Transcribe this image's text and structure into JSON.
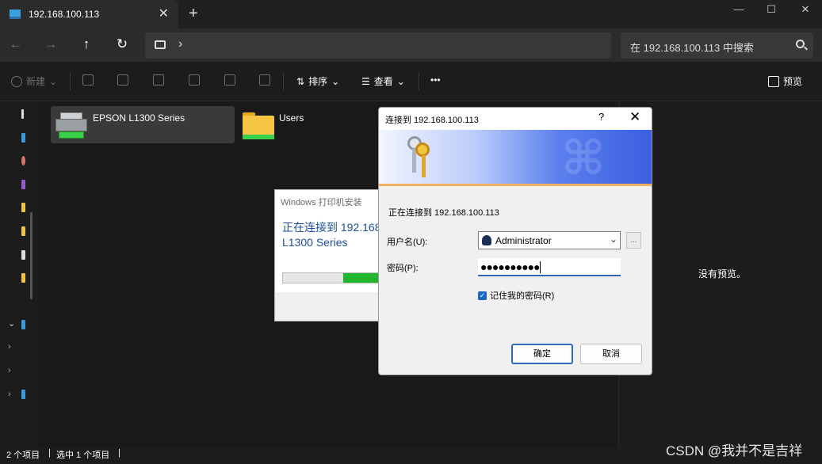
{
  "tab": {
    "title": "192.168.100.113",
    "close": "✕",
    "add": "+"
  },
  "window_controls": {
    "minimize": "—",
    "maximize": "☐",
    "close": "✕"
  },
  "nav": {
    "back": "←",
    "forward": "→",
    "up": "↑",
    "refresh": "↻",
    "chevron": "›"
  },
  "search": {
    "placeholder": "在 192.168.100.113 中搜索"
  },
  "toolbar": {
    "new_label": "新建",
    "sort_label": "排序",
    "view_label": "查看",
    "more_label": "•••",
    "preview_label": "预览",
    "dropdown": "⌄"
  },
  "files": [
    {
      "name": "EPSON L1300 Series",
      "type": "printer",
      "selected": true
    },
    {
      "name": "Users",
      "type": "folder",
      "selected": false
    }
  ],
  "preview": {
    "empty_text": "没有预览。"
  },
  "status": {
    "count": "2 个项目",
    "selected": "选中 1 个项目",
    "divider": "|"
  },
  "watermark": "CSDN @我并不是吉祥",
  "installer": {
    "title": "Windows 打印机安装",
    "message_line1": "正在连接到 192.168.",
    "message_line2": "L1300 Series",
    "progress": 0.45
  },
  "dialog": {
    "title": "连接到 192.168.100.113",
    "help": "?",
    "close": "✕",
    "connecting": "正在连接到 192.168.100.113",
    "username_label": "用户名(U):",
    "username_value": "Administrator",
    "password_label": "密码(P):",
    "password_value": "●●●●●●●●●●",
    "browse": "...",
    "remember_label": "记住我的密码(R)",
    "remember_checked": true,
    "ok_label": "确定",
    "cancel_label": "取消"
  },
  "colors": {
    "accent": "#2e6ac0",
    "progress_green": "#1fb52d",
    "banner_blue": "#3a5fe0"
  }
}
